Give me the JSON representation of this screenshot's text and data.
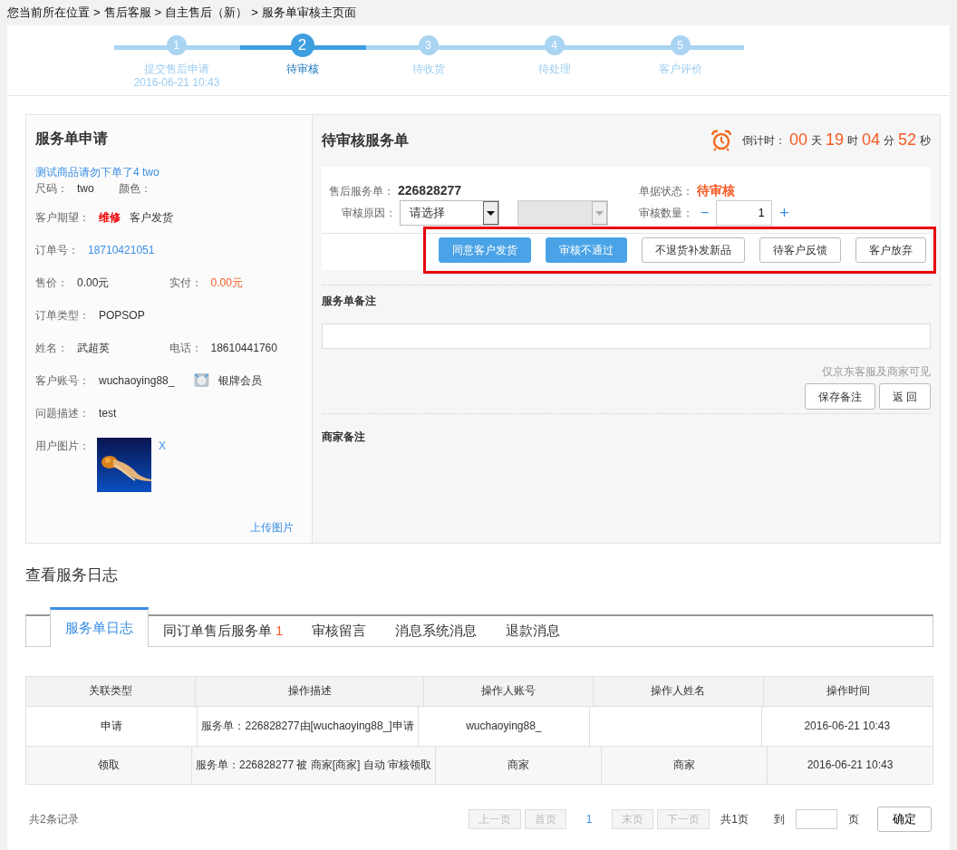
{
  "breadcrumb": [
    "您当前所在位置",
    "售后客服",
    "自主售后（新）",
    "服务单审核主页面"
  ],
  "breadcrumb_separator": ">",
  "steps": [
    {
      "number": "1",
      "label": "提交售后申请",
      "date": "2016-06-21 10:43",
      "selected": false
    },
    {
      "number": "2",
      "label": "待审核",
      "selected": true
    },
    {
      "number": "3",
      "label": "待收货",
      "selected": false
    },
    {
      "number": "4",
      "label": "待处理",
      "selected": false
    },
    {
      "number": "5",
      "label": "客户评价",
      "selected": false
    }
  ],
  "application": {
    "title": "服务单申请",
    "product_link": "测试商品请勿下单了4 two",
    "rows": [
      {
        "fields": [
          {
            "label": "尺码：",
            "values": [
              {
                "text": "two",
                "kind": "plain"
              }
            ]
          },
          {
            "label": "颜色："
          }
        ]
      },
      {
        "fields": [
          {
            "label": "客户期望：",
            "values": [
              {
                "text": "维修",
                "kind": "emphasis"
              },
              {
                "text": "客户发货",
                "kind": "plain"
              }
            ]
          }
        ]
      },
      {
        "fields": [
          {
            "label": "订单号：",
            "values": [
              {
                "text": "18710421051",
                "kind": "link"
              }
            ]
          }
        ]
      },
      {
        "fields": [
          {
            "label": "售价：",
            "values": [
              {
                "text": "0.00元",
                "kind": "plain"
              }
            ]
          },
          {
            "label": "实付：",
            "values": [
              {
                "text": "0.00元",
                "kind": "price"
              }
            ]
          }
        ]
      },
      {
        "fields": [
          {
            "label": "订单类型：",
            "values": [
              {
                "text": "POPSOP",
                "kind": "plain"
              }
            ]
          }
        ]
      },
      {
        "fields": [
          {
            "label": "姓名：",
            "values": [
              {
                "text": "武超英",
                "kind": "plain"
              }
            ]
          },
          {
            "label": "电话：",
            "values": [
              {
                "text": "18610441760",
                "kind": "plain"
              }
            ]
          }
        ]
      },
      {
        "fields": [
          {
            "label": "客户账号：",
            "values": [
              {
                "text": "wuchaoying88_",
                "kind": "plain"
              },
              {
                "text": "银牌会员",
                "kind": "member"
              }
            ]
          }
        ]
      },
      {
        "fields": [
          {
            "label": "问题描述：",
            "values": [
              {
                "text": "test",
                "kind": "plain"
              }
            ]
          }
        ]
      }
    ],
    "picture_label": "用户图片：",
    "remove_link": "X",
    "upload_link": "上传图片"
  },
  "review": {
    "title": "待审核服务单",
    "countdown_label": "倒计时：",
    "countdown": [
      {
        "number": "00",
        "unit": "天"
      },
      {
        "number": "19",
        "unit": "时"
      },
      {
        "number": "04",
        "unit": "分"
      },
      {
        "number": "52",
        "unit": "秒"
      }
    ],
    "order_label": "售后服务单：",
    "order_number": "226828277",
    "status_label": "单据状态：",
    "status": "待审核",
    "reason_label": "审核原因：",
    "reason_value": "请选择",
    "quantity_label": "审核数量：",
    "quantity_minus": "−",
    "quantity": "1",
    "quantity_plus": "+",
    "buttons_highlighted": true,
    "buttons": [
      {
        "label": "同意客户发货",
        "kind": "primary"
      },
      {
        "label": "审核不通过",
        "kind": "primary"
      },
      {
        "label": "不退货补发新品",
        "kind": "default"
      },
      {
        "label": "待客户反馈",
        "kind": "default"
      },
      {
        "label": "客户放弃",
        "kind": "default"
      }
    ],
    "remark_title": "服务单备注",
    "remark_hint": "仅京东客服及商家可见",
    "remark_buttons": [
      "保存备注",
      "返 回"
    ],
    "merchant_remark_title": "商家备注"
  },
  "log": {
    "title": "查看服务日志",
    "tabs": [
      {
        "label": "服务单日志",
        "selected": true
      },
      {
        "label": "同订单售后服务单",
        "count": "1",
        "selected": false
      },
      {
        "label": "审核留言",
        "selected": false
      },
      {
        "label": "消息系统消息",
        "selected": false
      },
      {
        "label": "退款消息",
        "selected": false
      }
    ],
    "columns": [
      "关联类型",
      "操作描述",
      "操作人账号",
      "操作人姓名",
      "操作时间"
    ],
    "rows": [
      [
        "申请",
        "服务单：226828277由[wuchaoying88_]申请",
        "wuchaoying88_",
        "",
        "2016-06-21 10:43"
      ],
      [
        "领取",
        "服务单：226828277 被 商家[商家] 自动 审核领取",
        "商家",
        "商家",
        "2016-06-21 10:43"
      ]
    ],
    "record_count": "共2条记录",
    "pager": [
      {
        "label": "上一页",
        "disabled": true
      },
      {
        "label": "首页",
        "disabled": true
      },
      {
        "label": "1",
        "kind": "current",
        "disabled": false
      },
      {
        "label": "末页",
        "disabled": true
      },
      {
        "label": "下一页",
        "disabled": true
      }
    ],
    "total_pages": "共1页",
    "goto_label": "到",
    "page_unit": "页",
    "confirm": "确定"
  }
}
